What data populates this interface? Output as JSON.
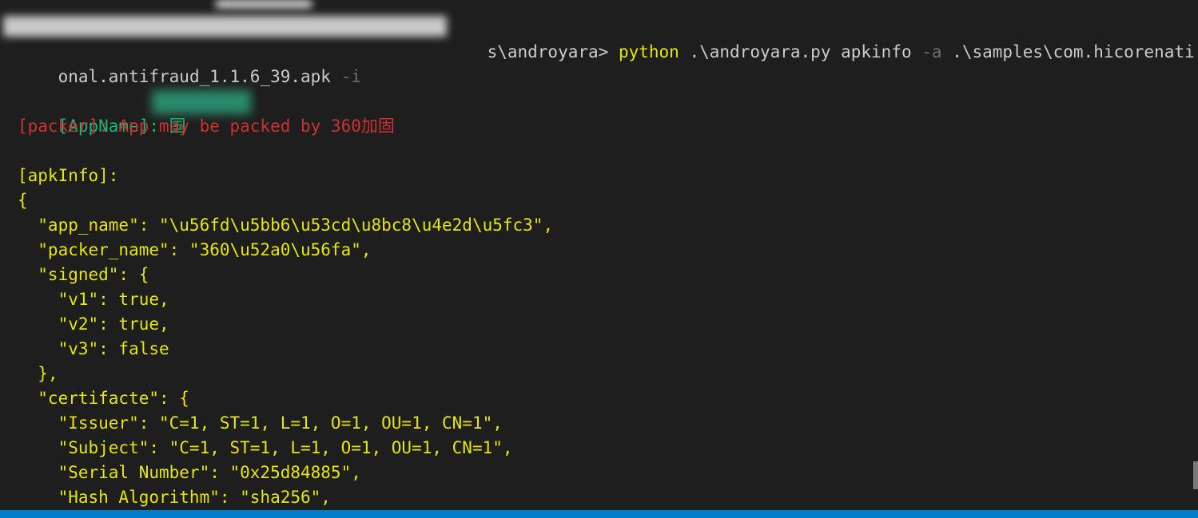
{
  "terminal": {
    "cmd": {
      "path_tail": "s\\androyara> ",
      "python": "python",
      "script": " .\\androyara.py apkinfo ",
      "flag_a": "-a",
      "target": " .\\samples\\com.hicorenati",
      "target_cont": "onal.antifraud_1.1.6_39.apk ",
      "flag_i": "-i"
    },
    "appname": {
      "label": "[AppName]: ",
      "value": "国"
    },
    "packer_line": "[packer]: App may be packed by 360加固",
    "apkinfo_header": "[apkInfo]:",
    "json_lines": [
      "{",
      "  \"app_name\": \"\\u56fd\\u5bb6\\u53cd\\u8bc8\\u4e2d\\u5fc3\",",
      "  \"packer_name\": \"360\\u52a0\\u56fa\",",
      "  \"signed\": {",
      "    \"v1\": true,",
      "    \"v2\": true,",
      "    \"v3\": false",
      "  },",
      "  \"certifacte\": {",
      "    \"Issuer\": \"C=1, ST=1, L=1, O=1, OU=1, CN=1\",",
      "    \"Subject\": \"C=1, ST=1, L=1, O=1, OU=1, CN=1\",",
      "    \"Serial Number\": \"0x25d84885\",",
      "    \"Hash Algorithm\": \"sha256\","
    ]
  },
  "colors": {
    "background": "#1e1e1e",
    "default_text": "#cccccc",
    "yellow": "#e5e510",
    "green": "#0dbc79",
    "red": "#cd3131",
    "dim": "#6f6f6f",
    "status_bar": "#007acc"
  }
}
